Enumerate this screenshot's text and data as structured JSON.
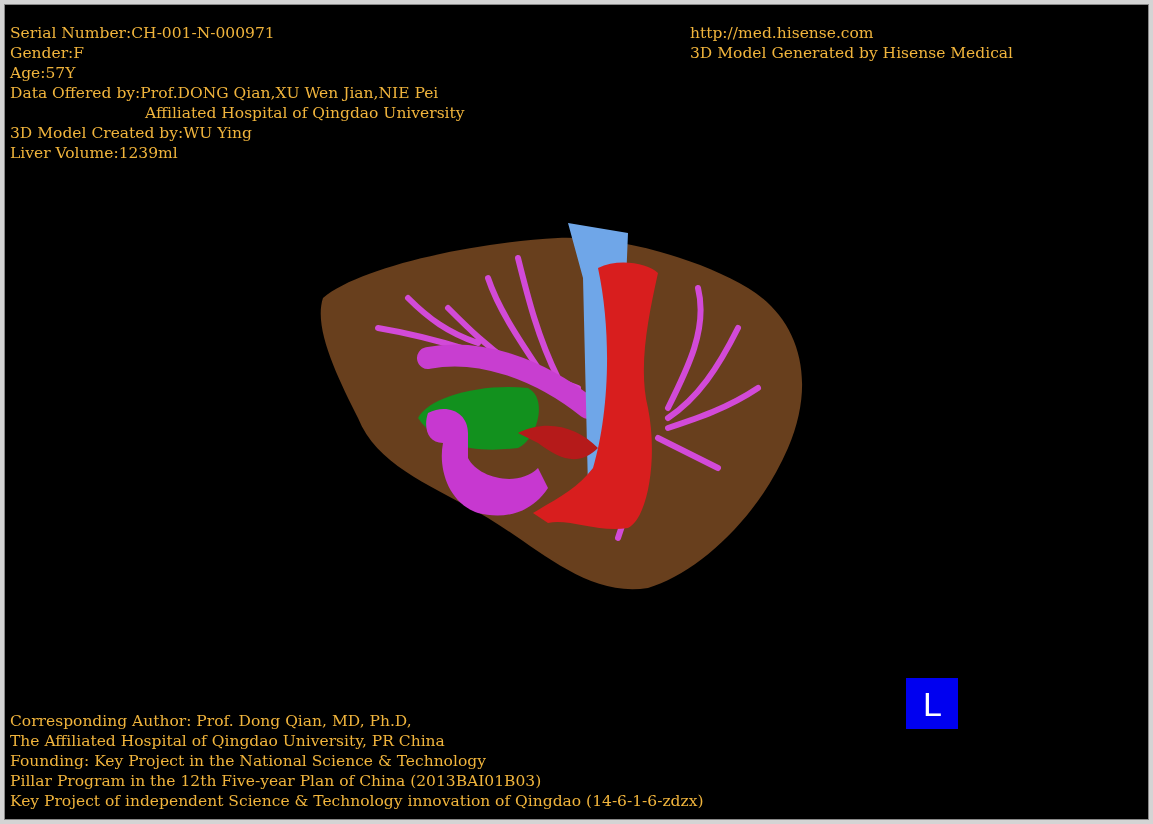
{
  "patient_info": [
    {
      "kind": "line",
      "text": "Serial Number:CH-001-N-000971"
    },
    {
      "kind": "line",
      "text": "Gender:F"
    },
    {
      "kind": "line",
      "text": "Age:57Y"
    },
    {
      "kind": "line",
      "text": "Data Offered by:Prof.DONG Qian,XU Wen Jian,NIE Pei"
    },
    {
      "kind": "continuation",
      "text": "Affiliated Hospital of Qingdao University"
    },
    {
      "kind": "line",
      "text": "3D Model Created by:WU Ying"
    },
    {
      "kind": "line",
      "text": "Liver Volume:1239ml"
    }
  ],
  "source_info": [
    "http://med.hisense.com",
    "3D Model Generated by Hisense Medical"
  ],
  "credits": [
    "Corresponding Author: Prof. Dong Qian, MD, Ph.D,",
    "The Affiliated Hospital of Qingdao University, PR China",
    "Founding: Key Project in the National Science & Technology",
    "Pillar Program in the 12th Five-year Plan of China (2013BAI01B03)",
    "Key Project of independent Science & Technology innovation of Qingdao (14-6-1-6-zdzx)"
  ],
  "orientation_marker": "L"
}
